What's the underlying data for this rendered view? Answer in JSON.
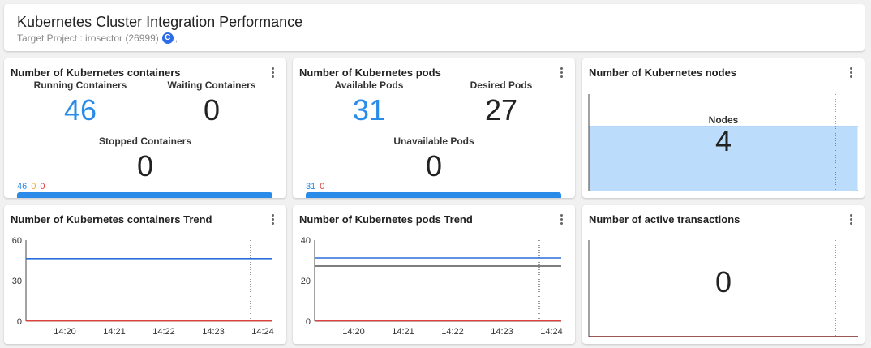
{
  "header": {
    "title": "Kubernetes Cluster Integration Performance",
    "subtitle": "Target Project : irosector (26999)",
    "badge": "C",
    "badge_suffix": ","
  },
  "containers": {
    "title": "Number of Kubernetes containers",
    "running_label": "Running Containers",
    "running_value": "46",
    "waiting_label": "Waiting Containers",
    "waiting_value": "0",
    "stopped_label": "Stopped Containers",
    "stopped_value": "0",
    "legend": [
      "46",
      "0",
      "0"
    ],
    "legend_colors": [
      "#2a8ce8",
      "#e8a23a",
      "#e04040"
    ]
  },
  "pods": {
    "title": "Number of Kubernetes pods",
    "available_label": "Available Pods",
    "available_value": "31",
    "desired_label": "Desired Pods",
    "desired_value": "27",
    "unavailable_label": "Unavailable Pods",
    "unavailable_value": "0",
    "legend": [
      "31",
      "0"
    ],
    "legend_colors": [
      "#2a8ce8",
      "#e04040"
    ]
  },
  "nodes": {
    "title": "Number of Kubernetes nodes",
    "label": "Nodes",
    "value": "4"
  },
  "containers_trend": {
    "title": "Number of Kubernetes containers Trend"
  },
  "pods_trend": {
    "title": "Number of Kubernetes pods Trend"
  },
  "active_tx": {
    "title": "Number of active transactions",
    "value": "0"
  },
  "chart_data": [
    {
      "type": "line",
      "title": "Number of Kubernetes containers Trend",
      "x": [
        "14:20",
        "14:21",
        "14:22",
        "14:23",
        "14:24"
      ],
      "ylim": [
        0,
        60
      ],
      "yticks": [
        0,
        30,
        60
      ],
      "series": [
        {
          "color": "#2a6fd8",
          "values": [
            46,
            46,
            46,
            46,
            46
          ]
        },
        {
          "color": "#c89a2a",
          "values": [
            0,
            0,
            0,
            0,
            0
          ]
        },
        {
          "color": "#e04040",
          "values": [
            0,
            0,
            0,
            0,
            0
          ]
        }
      ]
    },
    {
      "type": "line",
      "title": "Number of Kubernetes pods Trend",
      "x": [
        "14:20",
        "14:21",
        "14:22",
        "14:23",
        "14:24"
      ],
      "ylim": [
        0,
        40
      ],
      "yticks": [
        0,
        20,
        40
      ],
      "series": [
        {
          "color": "#2a6fd8",
          "values": [
            31,
            31,
            31,
            31,
            31
          ]
        },
        {
          "color": "#555555",
          "values": [
            27,
            27,
            27,
            27,
            27
          ]
        },
        {
          "color": "#e04040",
          "values": [
            0,
            0,
            0,
            0,
            0
          ]
        }
      ]
    }
  ]
}
